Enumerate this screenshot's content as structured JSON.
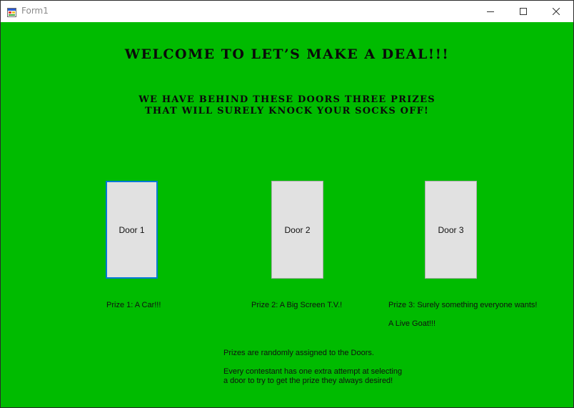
{
  "window": {
    "title": "Form1",
    "colors": {
      "background": "#00bb00",
      "button_face": "#e1e1e1",
      "focus_border": "#0078d7"
    },
    "controls": {
      "minimize_icon": "minimize-icon",
      "maximize_icon": "maximize-icon",
      "close_icon": "close-icon"
    }
  },
  "headline": {
    "welcome": "WELCOME TO LET’S MAKE A DEAL!!!",
    "sub_line1": "WE HAVE BEHIND THESE DOORS THREE PRIZES",
    "sub_line2": "THAT WILL SURELY KNOCK YOUR SOCKS OFF!"
  },
  "doors": [
    {
      "label": "Door 1",
      "focused": true
    },
    {
      "label": "Door 2",
      "focused": false
    },
    {
      "label": "Door 3",
      "focused": false
    }
  ],
  "prizes": [
    "Prize 1: A Car!!!",
    "Prize 2: A Big Screen T.V.!",
    "Prize 3: Surely something everyone wants!"
  ],
  "prize3_detail": "A Live Goat!!!",
  "info": {
    "line1": "Prizes are randomly assigned to the Doors.",
    "line2": "Every contestant has one extra attempt at selecting",
    "line3": "a door to try to get the prize they always desired!"
  }
}
